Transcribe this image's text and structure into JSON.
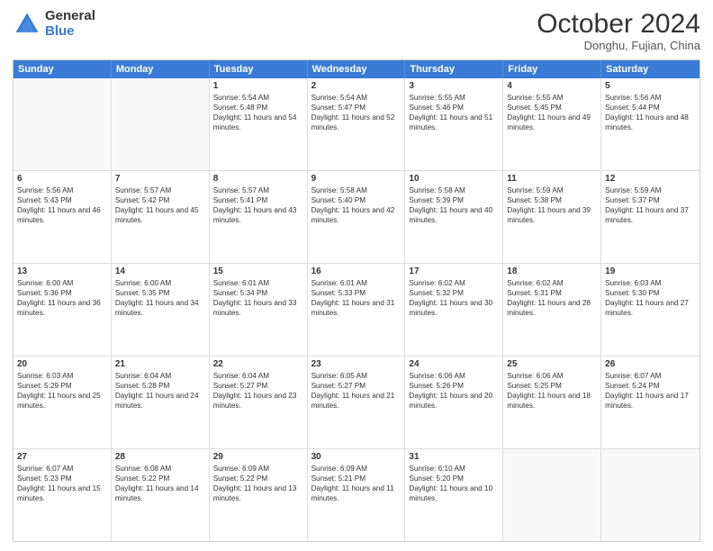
{
  "logo": {
    "general": "General",
    "blue": "Blue"
  },
  "header": {
    "month": "October 2024",
    "location": "Donghu, Fujian, China"
  },
  "weekdays": [
    "Sunday",
    "Monday",
    "Tuesday",
    "Wednesday",
    "Thursday",
    "Friday",
    "Saturday"
  ],
  "rows": [
    [
      {
        "day": "",
        "sunrise": "",
        "sunset": "",
        "daylight": ""
      },
      {
        "day": "",
        "sunrise": "",
        "sunset": "",
        "daylight": ""
      },
      {
        "day": "1",
        "sunrise": "Sunrise: 5:54 AM",
        "sunset": "Sunset: 5:48 PM",
        "daylight": "Daylight: 11 hours and 54 minutes."
      },
      {
        "day": "2",
        "sunrise": "Sunrise: 5:54 AM",
        "sunset": "Sunset: 5:47 PM",
        "daylight": "Daylight: 11 hours and 52 minutes."
      },
      {
        "day": "3",
        "sunrise": "Sunrise: 5:55 AM",
        "sunset": "Sunset: 5:46 PM",
        "daylight": "Daylight: 11 hours and 51 minutes."
      },
      {
        "day": "4",
        "sunrise": "Sunrise: 5:55 AM",
        "sunset": "Sunset: 5:45 PM",
        "daylight": "Daylight: 11 hours and 49 minutes."
      },
      {
        "day": "5",
        "sunrise": "Sunrise: 5:56 AM",
        "sunset": "Sunset: 5:44 PM",
        "daylight": "Daylight: 11 hours and 48 minutes."
      }
    ],
    [
      {
        "day": "6",
        "sunrise": "Sunrise: 5:56 AM",
        "sunset": "Sunset: 5:43 PM",
        "daylight": "Daylight: 11 hours and 46 minutes."
      },
      {
        "day": "7",
        "sunrise": "Sunrise: 5:57 AM",
        "sunset": "Sunset: 5:42 PM",
        "daylight": "Daylight: 11 hours and 45 minutes."
      },
      {
        "day": "8",
        "sunrise": "Sunrise: 5:57 AM",
        "sunset": "Sunset: 5:41 PM",
        "daylight": "Daylight: 11 hours and 43 minutes."
      },
      {
        "day": "9",
        "sunrise": "Sunrise: 5:58 AM",
        "sunset": "Sunset: 5:40 PM",
        "daylight": "Daylight: 11 hours and 42 minutes."
      },
      {
        "day": "10",
        "sunrise": "Sunrise: 5:58 AM",
        "sunset": "Sunset: 5:39 PM",
        "daylight": "Daylight: 11 hours and 40 minutes."
      },
      {
        "day": "11",
        "sunrise": "Sunrise: 5:59 AM",
        "sunset": "Sunset: 5:38 PM",
        "daylight": "Daylight: 11 hours and 39 minutes."
      },
      {
        "day": "12",
        "sunrise": "Sunrise: 5:59 AM",
        "sunset": "Sunset: 5:37 PM",
        "daylight": "Daylight: 11 hours and 37 minutes."
      }
    ],
    [
      {
        "day": "13",
        "sunrise": "Sunrise: 6:00 AM",
        "sunset": "Sunset: 5:36 PM",
        "daylight": "Daylight: 11 hours and 36 minutes."
      },
      {
        "day": "14",
        "sunrise": "Sunrise: 6:00 AM",
        "sunset": "Sunset: 5:35 PM",
        "daylight": "Daylight: 11 hours and 34 minutes."
      },
      {
        "day": "15",
        "sunrise": "Sunrise: 6:01 AM",
        "sunset": "Sunset: 5:34 PM",
        "daylight": "Daylight: 11 hours and 33 minutes."
      },
      {
        "day": "16",
        "sunrise": "Sunrise: 6:01 AM",
        "sunset": "Sunset: 5:33 PM",
        "daylight": "Daylight: 11 hours and 31 minutes."
      },
      {
        "day": "17",
        "sunrise": "Sunrise: 6:02 AM",
        "sunset": "Sunset: 5:32 PM",
        "daylight": "Daylight: 11 hours and 30 minutes."
      },
      {
        "day": "18",
        "sunrise": "Sunrise: 6:02 AM",
        "sunset": "Sunset: 5:31 PM",
        "daylight": "Daylight: 11 hours and 28 minutes."
      },
      {
        "day": "19",
        "sunrise": "Sunrise: 6:03 AM",
        "sunset": "Sunset: 5:30 PM",
        "daylight": "Daylight: 11 hours and 27 minutes."
      }
    ],
    [
      {
        "day": "20",
        "sunrise": "Sunrise: 6:03 AM",
        "sunset": "Sunset: 5:29 PM",
        "daylight": "Daylight: 11 hours and 25 minutes."
      },
      {
        "day": "21",
        "sunrise": "Sunrise: 6:04 AM",
        "sunset": "Sunset: 5:28 PM",
        "daylight": "Daylight: 11 hours and 24 minutes."
      },
      {
        "day": "22",
        "sunrise": "Sunrise: 6:04 AM",
        "sunset": "Sunset: 5:27 PM",
        "daylight": "Daylight: 11 hours and 23 minutes."
      },
      {
        "day": "23",
        "sunrise": "Sunrise: 6:05 AM",
        "sunset": "Sunset: 5:27 PM",
        "daylight": "Daylight: 11 hours and 21 minutes."
      },
      {
        "day": "24",
        "sunrise": "Sunrise: 6:06 AM",
        "sunset": "Sunset: 5:26 PM",
        "daylight": "Daylight: 11 hours and 20 minutes."
      },
      {
        "day": "25",
        "sunrise": "Sunrise: 6:06 AM",
        "sunset": "Sunset: 5:25 PM",
        "daylight": "Daylight: 11 hours and 18 minutes."
      },
      {
        "day": "26",
        "sunrise": "Sunrise: 6:07 AM",
        "sunset": "Sunset: 5:24 PM",
        "daylight": "Daylight: 11 hours and 17 minutes."
      }
    ],
    [
      {
        "day": "27",
        "sunrise": "Sunrise: 6:07 AM",
        "sunset": "Sunset: 5:23 PM",
        "daylight": "Daylight: 11 hours and 15 minutes."
      },
      {
        "day": "28",
        "sunrise": "Sunrise: 6:08 AM",
        "sunset": "Sunset: 5:22 PM",
        "daylight": "Daylight: 11 hours and 14 minutes."
      },
      {
        "day": "29",
        "sunrise": "Sunrise: 6:09 AM",
        "sunset": "Sunset: 5:22 PM",
        "daylight": "Daylight: 11 hours and 13 minutes."
      },
      {
        "day": "30",
        "sunrise": "Sunrise: 6:09 AM",
        "sunset": "Sunset: 5:21 PM",
        "daylight": "Daylight: 11 hours and 11 minutes."
      },
      {
        "day": "31",
        "sunrise": "Sunrise: 6:10 AM",
        "sunset": "Sunset: 5:20 PM",
        "daylight": "Daylight: 11 hours and 10 minutes."
      },
      {
        "day": "",
        "sunrise": "",
        "sunset": "",
        "daylight": ""
      },
      {
        "day": "",
        "sunrise": "",
        "sunset": "",
        "daylight": ""
      }
    ]
  ]
}
